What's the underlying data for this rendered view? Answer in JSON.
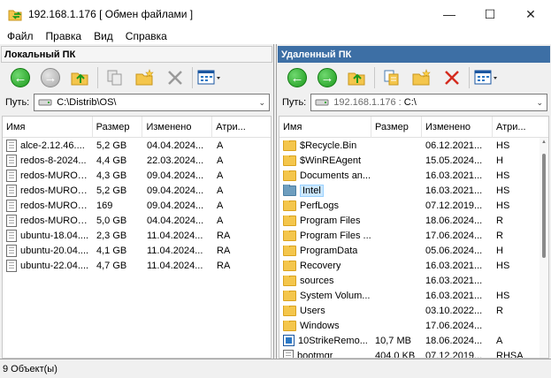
{
  "window": {
    "title": "192.168.1.176 [ Обмен файлами ]",
    "minimize": "—",
    "maximize": "☐",
    "close": "✕"
  },
  "menu": [
    "Файл",
    "Правка",
    "Вид",
    "Справка"
  ],
  "local": {
    "header": "Локальный ПК",
    "path_label": "Путь:",
    "path": "C:\\Distrib\\OS\\",
    "columns": [
      "Имя",
      "Размер",
      "Изменено",
      "Атри..."
    ],
    "rows": [
      {
        "name": "alce-2.12.46....",
        "size": "5,2 GB",
        "modified": "04.04.2024...",
        "attr": "A"
      },
      {
        "name": "redos-8-2024...",
        "size": "4,4 GB",
        "modified": "22.03.2024...",
        "attr": "A"
      },
      {
        "name": "redos-MUROM...",
        "size": "4,3 GB",
        "modified": "09.04.2024...",
        "attr": "A"
      },
      {
        "name": "redos-MUROM...",
        "size": "5,2 GB",
        "modified": "09.04.2024...",
        "attr": "A"
      },
      {
        "name": "redos-MUROM...",
        "size": "169",
        "modified": "09.04.2024...",
        "attr": "A"
      },
      {
        "name": "redos-MUROM...",
        "size": "5,0 GB",
        "modified": "04.04.2024...",
        "attr": "A"
      },
      {
        "name": "ubuntu-18.04....",
        "size": "2,3 GB",
        "modified": "11.04.2024...",
        "attr": "RA"
      },
      {
        "name": "ubuntu-20.04....",
        "size": "4,1 GB",
        "modified": "11.04.2024...",
        "attr": "RA"
      },
      {
        "name": "ubuntu-22.04....",
        "size": "4,7 GB",
        "modified": "11.04.2024...",
        "attr": "RA"
      }
    ]
  },
  "remote": {
    "header": "Удаленный ПК",
    "path_label": "Путь:",
    "path_host": "192.168.1.176 : ",
    "path": "C:\\",
    "columns": [
      "Имя",
      "Размер",
      "Изменено",
      "Атри..."
    ],
    "rows": [
      {
        "name": "$Recycle.Bin",
        "size": "",
        "modified": "06.12.2021...",
        "attr": "HS",
        "icon": "folder"
      },
      {
        "name": "$WinREAgent",
        "size": "",
        "modified": "15.05.2024...",
        "attr": "H",
        "icon": "folder"
      },
      {
        "name": "Documents an...",
        "size": "",
        "modified": "16.03.2021...",
        "attr": "HS",
        "icon": "folder"
      },
      {
        "name": "Intel",
        "size": "",
        "modified": "16.03.2021...",
        "attr": "HS",
        "icon": "folder-selected"
      },
      {
        "name": "PerfLogs",
        "size": "",
        "modified": "07.12.2019...",
        "attr": "HS",
        "icon": "folder"
      },
      {
        "name": "Program Files",
        "size": "",
        "modified": "18.06.2024...",
        "attr": "R",
        "icon": "folder"
      },
      {
        "name": "Program Files ...",
        "size": "",
        "modified": "17.06.2024...",
        "attr": "R",
        "icon": "folder"
      },
      {
        "name": "ProgramData",
        "size": "",
        "modified": "05.06.2024...",
        "attr": "H",
        "icon": "folder"
      },
      {
        "name": "Recovery",
        "size": "",
        "modified": "16.03.2021...",
        "attr": "HS",
        "icon": "folder"
      },
      {
        "name": "sources",
        "size": "",
        "modified": "16.03.2021...",
        "attr": "",
        "icon": "folder"
      },
      {
        "name": "System Volum...",
        "size": "",
        "modified": "16.03.2021...",
        "attr": "HS",
        "icon": "folder"
      },
      {
        "name": "Users",
        "size": "",
        "modified": "03.10.2022...",
        "attr": "R",
        "icon": "folder"
      },
      {
        "name": "Windows",
        "size": "",
        "modified": "17.06.2024...",
        "attr": "",
        "icon": "folder"
      },
      {
        "name": "10StrikeRemo...",
        "size": "10,7 MB",
        "modified": "18.06.2024...",
        "attr": "A",
        "icon": "app"
      },
      {
        "name": "bootmgr",
        "size": "404,0 KB",
        "modified": "07.12.2019...",
        "attr": "RHSA",
        "icon": "file"
      }
    ]
  },
  "status": {
    "text": "9 Объект(ы)"
  },
  "colors": {
    "remote_header_bg": "#3d6fa5",
    "selection": "#cce8ff",
    "nav_green": "#1c9a1c",
    "delete_red": "#d42b1e"
  }
}
